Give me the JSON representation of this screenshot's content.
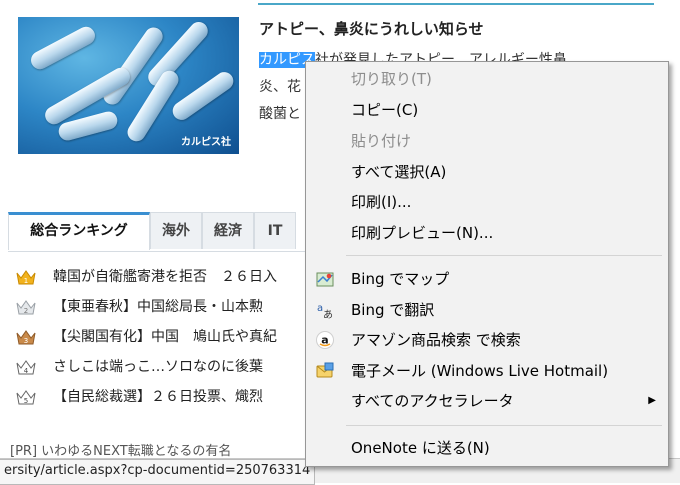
{
  "article": {
    "title": "アトピー、鼻炎にうれしい知らせ",
    "image_credit": "カルピス社",
    "highlighted": "カルピス",
    "body_line1_rest": "社が発見したアトピー、アレルギー性鼻",
    "body_line2": "炎、花",
    "body_line3": "酸菌と"
  },
  "ranking": {
    "tabs": [
      "総合ランキング",
      "海外",
      "経済",
      "IT"
    ],
    "items": [
      {
        "rank": "1",
        "text": "韓国が自衛艦寄港を拒否　２６日入"
      },
      {
        "rank": "2",
        "text": "【東亜春秋】中国総局長・山本勲"
      },
      {
        "rank": "3",
        "text": "【尖閣国有化】中国　鳩山氏や真紀"
      },
      {
        "rank": "4",
        "text": "さしこは端っこ…ソロなのに後葉"
      },
      {
        "rank": "5",
        "text": "【自民総裁選】２６日投票、熾烈"
      }
    ],
    "crown_colors": [
      "#f2b21d",
      "#b9bec4",
      "#c98a4a",
      "#ffffff",
      "#ffffff"
    ]
  },
  "pr_line": "[PR] いわゆるNEXT転職となるの有名",
  "status_url": "ersity/article.aspx?cp-documentid=250763314",
  "context_menu": {
    "items": [
      {
        "label": "切り取り(T)",
        "disabled": true
      },
      {
        "label": "コピー(C)",
        "disabled": false
      },
      {
        "label": "貼り付け",
        "disabled": true
      },
      {
        "label": "すべて選択(A)",
        "disabled": false
      },
      {
        "label": "印刷(I)...",
        "disabled": false
      },
      {
        "label": "印刷プレビュー(N)...",
        "disabled": false
      },
      {
        "label": "Bing でマップ",
        "icon": "map-icon"
      },
      {
        "label": "Bing で翻訳",
        "icon": "translate-icon"
      },
      {
        "label": "アマゾン商品検索 で検索",
        "icon": "amazon-icon"
      },
      {
        "label": "電子メール (Windows Live Hotmail)",
        "icon": "mail-icon"
      },
      {
        "label": "すべてのアクセラレータ",
        "submenu": true
      },
      {
        "label": "OneNote に送る(N)"
      }
    ]
  }
}
